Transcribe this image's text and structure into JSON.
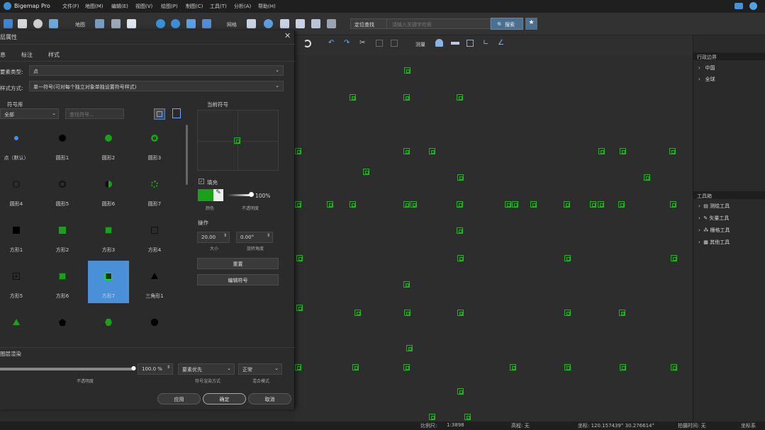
{
  "app": {
    "title": "Bigemap Pro",
    "menu": [
      "文件(F)",
      "地图(M)",
      "编辑(E)",
      "视图(V)",
      "绘图(P)",
      "制图(C)",
      "工具(T)",
      "分析(A)",
      "帮助(H)"
    ]
  },
  "toolbar": {
    "map_label": "地图",
    "grid_label": "网格",
    "search_type": "定位查找",
    "search_placeholder": "请输入关键字检索",
    "search_button": "搜索",
    "measure_label": "测量"
  },
  "right_panel": {
    "admin_header": "行政边界",
    "admin_items": [
      "中国",
      "全球"
    ],
    "toolbox_header": "工具箱",
    "toolbox_items": [
      "测绘工具",
      "矢量工具",
      "栅格工具",
      "其他工具"
    ]
  },
  "status": {
    "scale_label": "比例尺:",
    "scale_value": "1:3898",
    "elevation": "高程: 无",
    "coords": "坐标: 120.157439°  30.276614°",
    "shoot_time": "拍摄时间: 无",
    "coord_system": "坐标系"
  },
  "dialog": {
    "title": "层属性",
    "tabs": [
      "息",
      "标注",
      "样式"
    ],
    "element_type_label": "要素类型:",
    "element_type_value": "点",
    "style_mode_label": "样式方式:",
    "style_mode_value": "单一符号(可对每个独立对象单独设置符号样式)",
    "library_label": "符号库",
    "library_filter": "全部",
    "symbol_search_placeholder": "查找符号...",
    "current_symbol_label": "当前符号",
    "fill_label": "填充",
    "color_label": "颜色",
    "opacity_label": "不透明度",
    "opacity_value": "100%",
    "operate_label": "操作",
    "size_value": "20.00",
    "size_label": "大小",
    "rotation_value": "0.00°",
    "rotation_label": "旋转角度",
    "reset_button": "重置",
    "edit_symbol_button": "编辑符号",
    "layer_render_label": "图层渲染",
    "layer_opacity_label": "不透明度",
    "layer_opacity_value": "100.0 %",
    "render_mode_value": "要素优先",
    "render_mode_label": "符号渲染方式",
    "blend_value": "正常",
    "blend_label": "混合模式",
    "apply_button": "应用",
    "ok_button": "确定",
    "cancel_button": "取消",
    "symbols": [
      "点（默认）",
      "圆形1",
      "圆形2",
      "圆形3",
      "圆形4",
      "圆形5",
      "圆形6",
      "圆形7",
      "方形1",
      "方形2",
      "方形3",
      "方形4",
      "方形5",
      "方形6",
      "方形7",
      "三角形1"
    ],
    "selected_symbol": "方形7",
    "fill_color": "#1aa01a"
  }
}
